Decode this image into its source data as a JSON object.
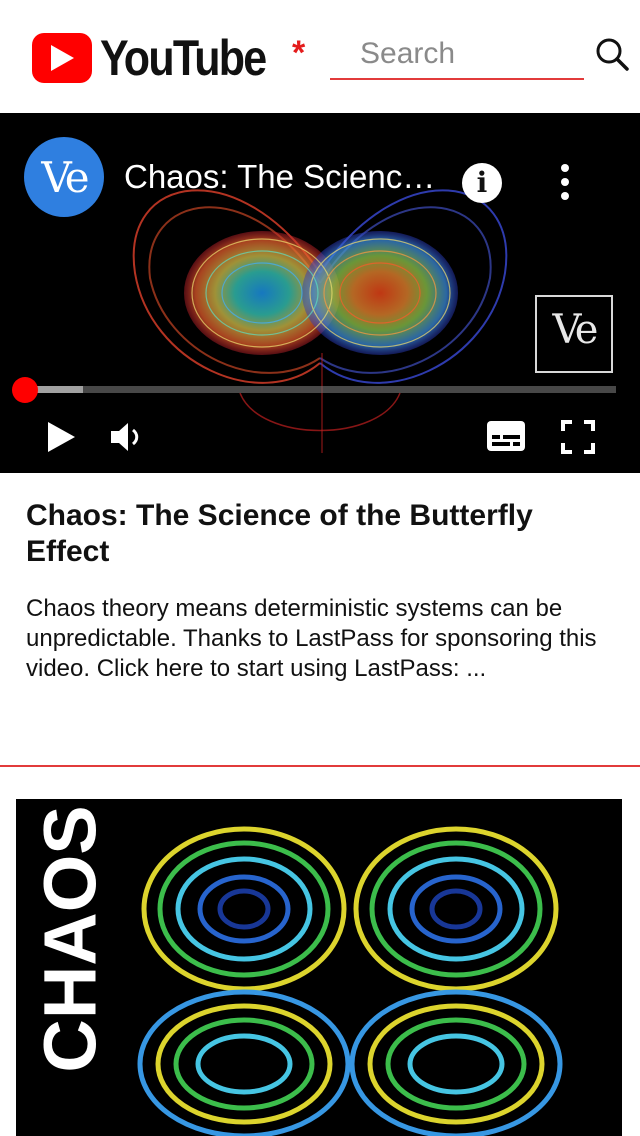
{
  "header": {
    "logo_text": "YouTube",
    "logo_star": "*",
    "search_placeholder": "Search",
    "search_value": "",
    "icons": {
      "logo_play": "play-triangle-icon",
      "search": "magnifier-icon"
    },
    "brand_color": "#ff0000",
    "accent_color": "#e23b3b"
  },
  "player": {
    "channel_avatar_text": "Ve",
    "title": "Chaos: The Science of the Butterfly Effect",
    "info_icon_text": "i",
    "watermark_text": "Ve",
    "progress_fraction": 0.0,
    "buffer_fraction": 0.1,
    "icons": {
      "info": "info-icon",
      "more": "more-vert-icon",
      "play": "play-icon",
      "volume": "volume-icon",
      "captions": "captions-icon",
      "fullscreen": "fullscreen-icon"
    }
  },
  "video": {
    "heading": "Chaos: The Science of the Butterfly Effect",
    "description": "Chaos theory means deterministic systems can be unpredictable. Thanks to LastPass for sponsoring this video. Click here to start using LastPass: ..."
  },
  "next_video": {
    "thumbnail_text": "CHAOS"
  }
}
